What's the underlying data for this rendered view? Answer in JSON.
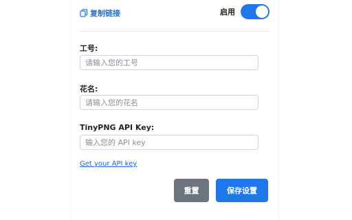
{
  "header": {
    "copy_link_label": "复制链接",
    "enable_label": "启用",
    "enabled": true
  },
  "form": {
    "employee_id": {
      "label": "工号:",
      "placeholder": "请输入您的工号",
      "value": ""
    },
    "nickname": {
      "label": "花名:",
      "placeholder": "请输入您的花名",
      "value": ""
    },
    "api_key": {
      "label": "TinyPNG API Key:",
      "placeholder": "输入您的 API key",
      "value": ""
    },
    "api_key_link": "Get your API key"
  },
  "actions": {
    "reset_label": "重置",
    "save_label": "保存设置"
  },
  "colors": {
    "accent": "#1e78ec",
    "link": "#1e73d8",
    "secondary_button": "#6c757d"
  },
  "icons": {
    "copy": "copy-icon"
  }
}
